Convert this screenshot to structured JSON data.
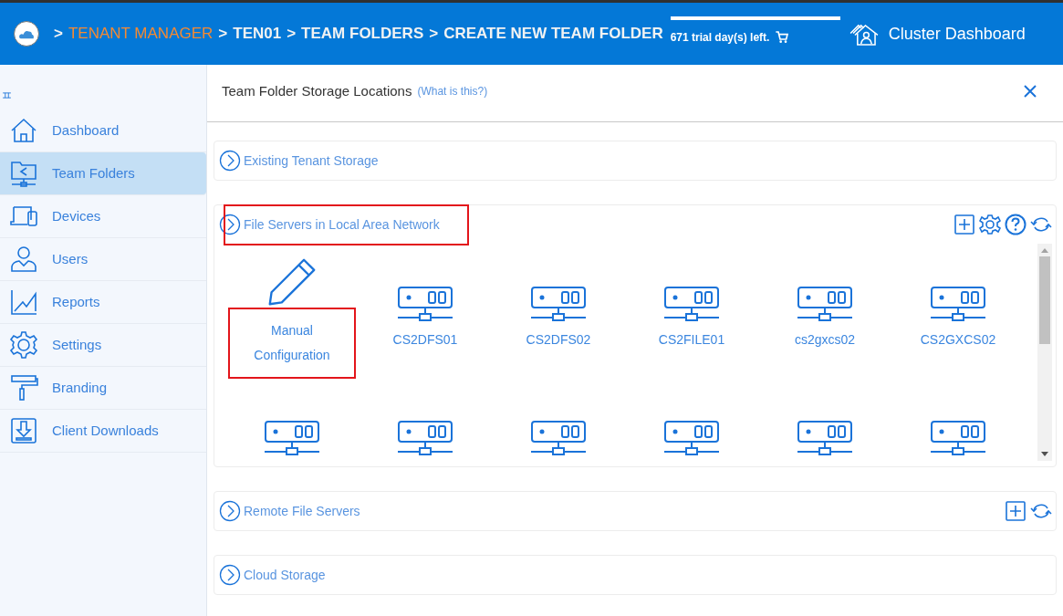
{
  "header": {
    "breadcrumbs": [
      {
        "label": ">",
        "kind": "sep"
      },
      {
        "label": "TENANT MANAGER",
        "kind": "link"
      },
      {
        "label": ">",
        "kind": "sep"
      },
      {
        "label": "TEN01",
        "kind": "crumb"
      },
      {
        "label": ">",
        "kind": "sep"
      },
      {
        "label": "TEAM FOLDERS",
        "kind": "crumb"
      },
      {
        "label": ">",
        "kind": "sep"
      },
      {
        "label": "CREATE NEW TEAM FOLDER",
        "kind": "crumb"
      }
    ],
    "trial": "671 trial day(s) left.",
    "dashboard": "Cluster Dashboard"
  },
  "sidebar": {
    "items": [
      {
        "label": "Dashboard",
        "kind": "home",
        "selected": false
      },
      {
        "label": "Team Folders",
        "kind": "folder",
        "selected": true
      },
      {
        "label": "Devices",
        "kind": "devices",
        "selected": false
      },
      {
        "label": "Users",
        "kind": "user",
        "selected": false
      },
      {
        "label": "Reports",
        "kind": "chart",
        "selected": false
      },
      {
        "label": "Settings",
        "kind": "gear",
        "selected": false
      },
      {
        "label": "Branding",
        "kind": "roller",
        "selected": false
      },
      {
        "label": "Client Downloads",
        "kind": "download",
        "selected": false
      }
    ]
  },
  "panel": {
    "title": "Team Folder Storage Locations",
    "help_link": "(What is this?)",
    "sections": [
      {
        "title": "Existing Tenant Storage",
        "highlighted": false
      },
      {
        "title": "File Servers in Local Area Network",
        "highlighted": true,
        "actions": [
          {
            "kind": "add"
          },
          {
            "kind": "settings"
          },
          {
            "kind": "help"
          },
          {
            "kind": "refresh"
          }
        ],
        "items": [
          {
            "kind": "manual",
            "label": "Manual Configuration",
            "highlighted": true
          },
          {
            "kind": "server",
            "label": "CS2DFS01"
          },
          {
            "kind": "server",
            "label": "CS2DFS02"
          },
          {
            "kind": "server",
            "label": "CS2FILE01"
          },
          {
            "kind": "server",
            "label": "cs2gxcs02"
          },
          {
            "kind": "server",
            "label": "CS2GXCS02"
          },
          {
            "kind": "server"
          },
          {
            "kind": "server"
          },
          {
            "kind": "server"
          },
          {
            "kind": "server"
          },
          {
            "kind": "server"
          },
          {
            "kind": "server"
          }
        ]
      },
      {
        "title": "Remote File Servers",
        "highlighted": false,
        "actions": [
          {
            "kind": "add"
          },
          {
            "kind": "refresh"
          }
        ]
      },
      {
        "title": "Cloud Storage",
        "highlighted": false
      }
    ]
  }
}
